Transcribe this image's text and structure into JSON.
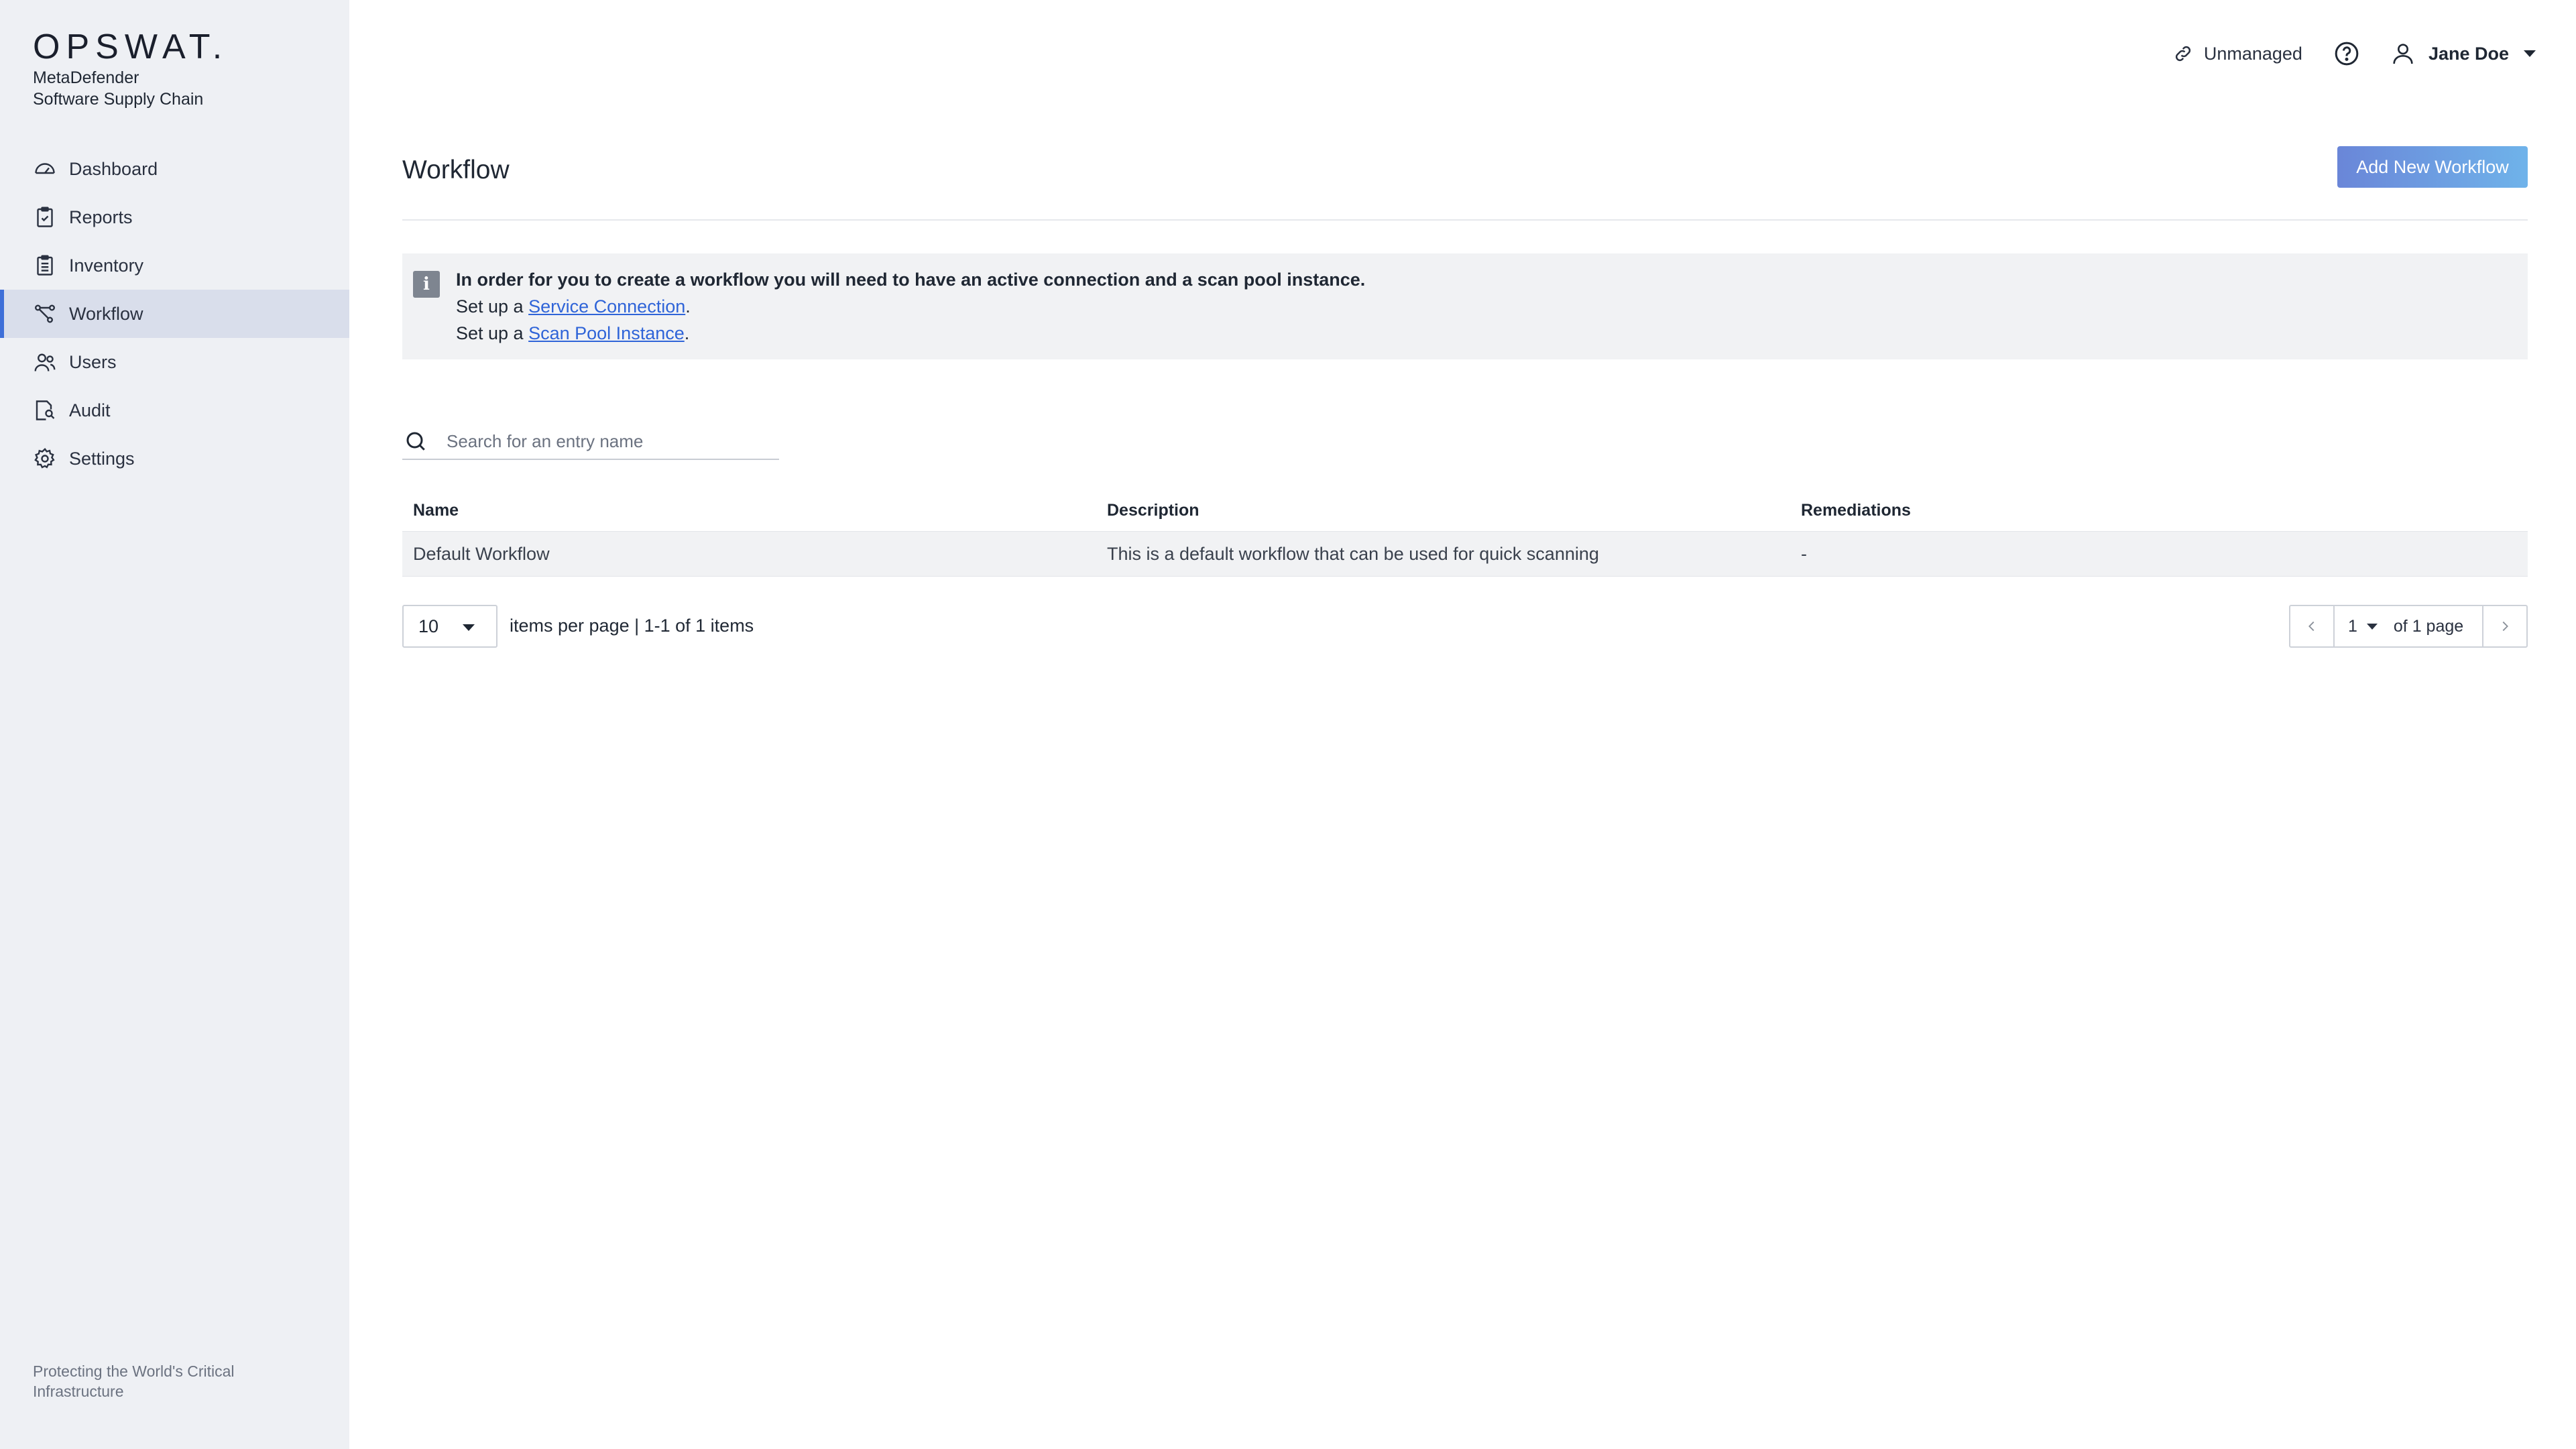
{
  "sidebar": {
    "logo": "OPSWAT.",
    "product_line1": "MetaDefender",
    "product_line2": "Software Supply Chain",
    "items": [
      {
        "label": "Dashboard",
        "icon": "dashboard-gauge-icon"
      },
      {
        "label": "Reports",
        "icon": "clipboard-check-icon"
      },
      {
        "label": "Inventory",
        "icon": "clipboard-list-icon"
      },
      {
        "label": "Workflow",
        "icon": "workflow-nodes-icon",
        "active": true
      },
      {
        "label": "Users",
        "icon": "users-icon"
      },
      {
        "label": "Audit",
        "icon": "audit-icon"
      },
      {
        "label": "Settings",
        "icon": "gear-icon"
      }
    ],
    "footer": "Protecting the World's Critical Infrastructure"
  },
  "topbar": {
    "status_label": "Unmanaged",
    "status_icon": "link-icon",
    "help_icon": "help-circle-icon",
    "user_name": "Jane Doe",
    "user_icon": "user-icon"
  },
  "main": {
    "title": "Workflow",
    "add_button": "Add New Workflow",
    "notice": {
      "heading": "In order for you to create a workflow you will need to have an active connection and a scan pool instance.",
      "line2_prefix": "Set up a ",
      "line2_link": "Service Connection",
      "line2_suffix": ".",
      "line3_prefix": "Set up a ",
      "line3_link": "Scan Pool Instance",
      "line3_suffix": "."
    },
    "search": {
      "placeholder": "Search for an entry name",
      "value": ""
    },
    "table": {
      "columns": [
        "Name",
        "Description",
        "Remediations"
      ],
      "rows": [
        {
          "name": "Default Workflow",
          "description": "This is a default workflow that can be used for quick scanning",
          "remediations": "-"
        }
      ]
    },
    "pagination": {
      "page_size": "10",
      "info": "items per page | 1-1 of 1 items",
      "current_page": "1",
      "of_pages": "of 1 page"
    }
  },
  "colors": {
    "accent": "#3e6fd8",
    "button_gradient_start": "#6a86d8",
    "button_gradient_end": "#6fb3ea",
    "sidebar_bg": "#eef0f4",
    "link": "#2f64d8"
  }
}
